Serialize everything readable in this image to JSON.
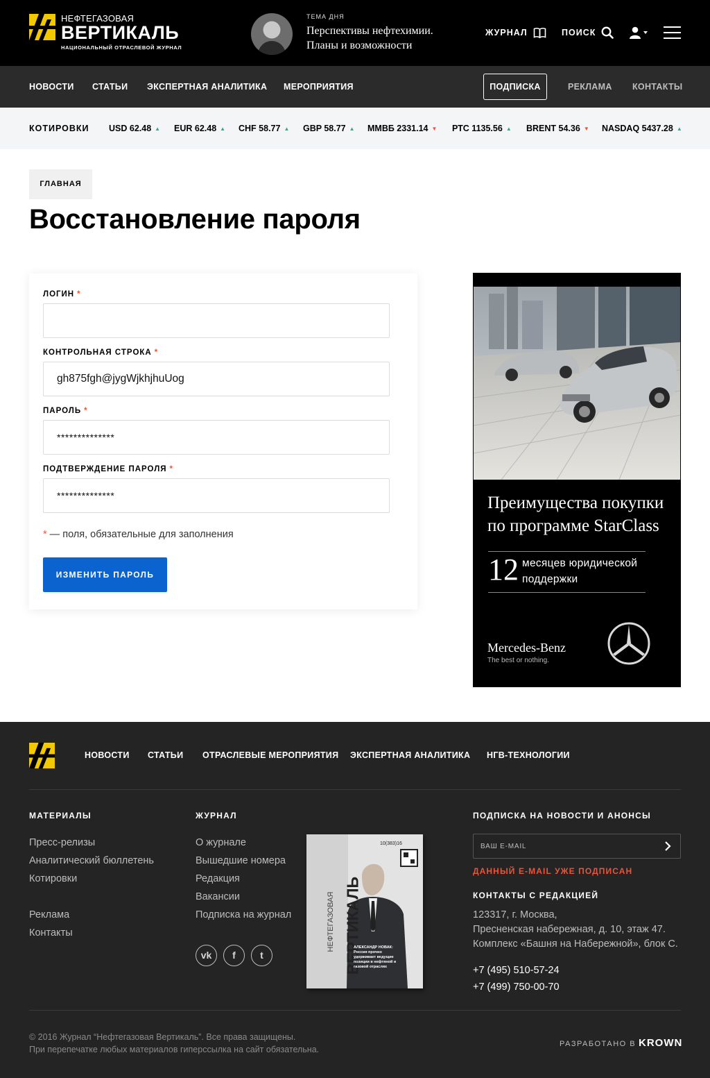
{
  "header": {
    "logo_line1": "НЕФТЕГАЗОВАЯ",
    "logo_line2": "ВЕРТИКАЛЬ",
    "logo_line3": "НАЦИОНАЛЬНЫЙ ОТРАСЛЕВОЙ ЖУРНАЛ",
    "theme_label": "ТЕМА ДНЯ",
    "theme_title": "Перспективы нефтехимии. Планы и возможности",
    "journal_label": "ЖУРНАЛ",
    "search_label": "ПОИСК"
  },
  "nav": {
    "items": [
      "НОВОСТИ",
      "СТАТЬИ",
      "ЭКСПЕРТНАЯ АНАЛИТИКА",
      "МЕРОПРИЯТИЯ"
    ],
    "subscribe": "ПОДПИСКА",
    "ads": "РЕКЛАМА",
    "contacts": "КОНТАКТЫ"
  },
  "quotes": {
    "label": "КОТИРОВКИ",
    "items": [
      {
        "text": "USD 62.48",
        "dir": "up"
      },
      {
        "text": "EUR 62.48",
        "dir": "up"
      },
      {
        "text": "CHF 58.77",
        "dir": "up"
      },
      {
        "text": "GBP 58.77",
        "dir": "up"
      },
      {
        "text": "ММВБ 2331.14",
        "dir": "down"
      },
      {
        "text": "РТС 1135.56",
        "dir": "up"
      },
      {
        "text": "BRENT 54.36",
        "dir": "down"
      },
      {
        "text": "NASDAQ 5437.28",
        "dir": "up"
      }
    ]
  },
  "breadcrumb": "ГЛАВНАЯ",
  "page_title": "Восстановление пароля",
  "form": {
    "login_label": "ЛОГИН",
    "login_value": "",
    "control_label": "КОНТРОЛЬНАЯ СТРОКА",
    "control_value": "gh875fgh@jygWjkhjhuUog",
    "password_label": "ПАРОЛЬ",
    "password_value": "**************",
    "confirm_label": "ПОДТВЕРЖДЕНИЕ ПАРОЛЯ",
    "confirm_value": "**************",
    "required_mark": "*",
    "note": " — поля, обязательные для заполнения",
    "submit": "ИЗМЕНИТЬ ПАРОЛЬ"
  },
  "ad": {
    "headline": "Преимущества покупки по программе StarClass",
    "number": "12",
    "desc": "месяцев юридической поддержки",
    "brand": "Mercedes-Benz",
    "tagline": "The best or nothing."
  },
  "footer": {
    "nav": [
      "НОВОСТИ",
      "СТАТЬИ",
      "ОТРАСЛЕВЫЕ МЕРОПРИЯТИЯ",
      "ЭКСПЕРТНАЯ АНАЛИТИКА",
      "НГВ-ТЕХНОЛОГИИ"
    ],
    "materials_head": "МАТЕРИАЛЫ",
    "materials": [
      "Пресс-релизы",
      "Аналитический бюллетень",
      "Котировки",
      "Реклама",
      "Контакты"
    ],
    "journal_head": "ЖУРНАЛ",
    "journal": [
      "О журнале",
      "Вышедшие номера",
      "Редакция",
      "Вакансии",
      "Подписка на журнал"
    ],
    "social": [
      "vk",
      "f",
      "t"
    ],
    "subscribe_head": "ПОДПИСКА НА НОВОСТИ И АНОНСЫ",
    "email_placeholder": "ВАШ E-MAIL",
    "email_error": "ДАННЫЙ E-MAIL УЖЕ ПОДПИСАН",
    "contacts_head": "КОНТАКТЫ С РЕДАКЦИЕЙ",
    "address": [
      "123317, г. Москва,",
      "Пресненская набережная, д. 10, этаж 47.",
      "Комплекс «Башня на Набережной», блок С."
    ],
    "phones": [
      "+7 (495) 510-57-24",
      "+7 (499) 750-00-70"
    ],
    "copyright1": "© 2016 Журнал “Нефтегазовая Вертикаль”. Все права защищены.",
    "copyright2": "При перепечатке любых материалов гиперссылка на сайт обязательна.",
    "developed_by": "РАЗРАБОТАНО В",
    "developer": "KROWN"
  },
  "cover": {
    "title_small": "НЕФТЕГАЗОВАЯ",
    "title_big": "ВЕРТИКАЛЬ",
    "issue": "10(383)16",
    "caption": "АЛЕКСАНДР НОВАК: Россия прочно удерживает ведущие позиции в нефтяной и газовой отраслях"
  },
  "colors": {
    "brand_yellow": "#f2c800",
    "accent_blue": "#0b63cf",
    "required_red": "#e8553a",
    "quote_up": "#27ae8a",
    "quote_down": "#e8553a"
  }
}
